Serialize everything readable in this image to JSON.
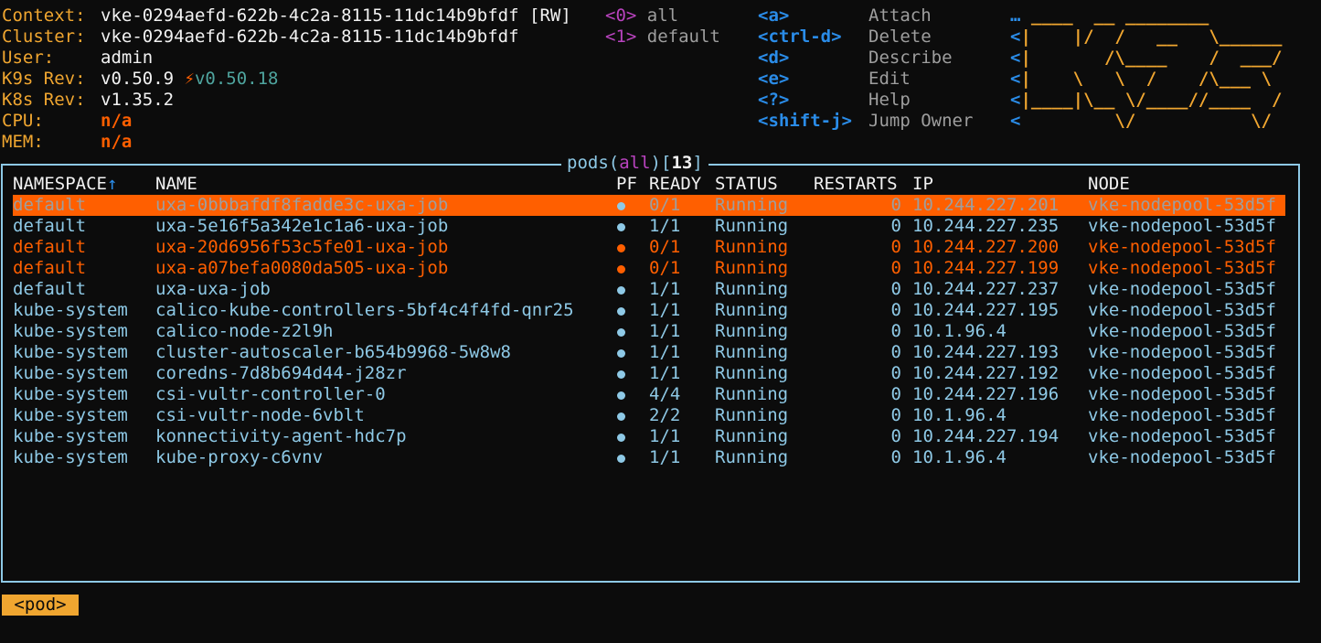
{
  "header": {
    "context_label": "Context:",
    "context_value": "vke-0294aefd-622b-4c2a-8115-11dc14b9bfdf",
    "rw": "[RW]",
    "cluster_label": "Cluster:",
    "cluster_value": "vke-0294aefd-622b-4c2a-8115-11dc14b9bfdf",
    "user_label": "User:",
    "user_value": "admin",
    "k9s_label": "K9s Rev:",
    "k9s_value": "v0.50.9",
    "k9s_update": "v0.50.18",
    "k8s_label": "K8s Rev:",
    "k8s_value": "v1.35.2",
    "cpu_label": "CPU:",
    "cpu_value": "n/a",
    "mem_label": "MEM:",
    "mem_value": "n/a"
  },
  "namespaces": [
    {
      "key": "<0>",
      "name": "all"
    },
    {
      "key": "<1>",
      "name": "default"
    }
  ],
  "hints": [
    {
      "key": "<a>",
      "label": "Attach"
    },
    {
      "key": "<ctrl-d>",
      "label": "Delete"
    },
    {
      "key": "<d>",
      "label": "Describe"
    },
    {
      "key": "<e>",
      "label": "Edit"
    },
    {
      "key": "<?>",
      "label": "Help"
    },
    {
      "key": "<shift-j>",
      "label": "Jump Owner"
    }
  ],
  "logo": [
    " ____  __ ________",
    "|    |/  /   __   \\______",
    "|       /\\____    /  ___/",
    "|    \\   \\  /    /\\___ \\",
    "|____|\\__ \\/____//____  /",
    "         \\/           \\/"
  ],
  "logo_prefix": [
    "…",
    "<",
    "<",
    "<",
    "<",
    "<"
  ],
  "table": {
    "title_resource": "pods",
    "title_scope": "all",
    "title_count": "13",
    "columns": [
      "NAMESPACE↑",
      "NAME",
      "PF",
      "READY",
      "STATUS",
      "RESTARTS",
      "IP",
      "NODE"
    ],
    "rows": [
      {
        "namespace": "default",
        "name": "uxa-0bbbafdf8fadde3c-uxa-job",
        "ready": "0/1",
        "status": "Running",
        "restarts": "0",
        "ip": "10.244.227.201",
        "node": "vke-nodepool-53d5f",
        "state": "sel"
      },
      {
        "namespace": "default",
        "name": "uxa-5e16f5a342e1c1a6-uxa-job",
        "ready": "1/1",
        "status": "Running",
        "restarts": "0",
        "ip": "10.244.227.235",
        "node": "vke-nodepool-53d5f",
        "state": "ok"
      },
      {
        "namespace": "default",
        "name": "uxa-20d6956f53c5fe01-uxa-job",
        "ready": "0/1",
        "status": "Running",
        "restarts": "0",
        "ip": "10.244.227.200",
        "node": "vke-nodepool-53d5f",
        "state": "err"
      },
      {
        "namespace": "default",
        "name": "uxa-a07befa0080da505-uxa-job",
        "ready": "0/1",
        "status": "Running",
        "restarts": "0",
        "ip": "10.244.227.199",
        "node": "vke-nodepool-53d5f",
        "state": "err"
      },
      {
        "namespace": "default",
        "name": "uxa-uxa-job",
        "ready": "1/1",
        "status": "Running",
        "restarts": "0",
        "ip": "10.244.227.237",
        "node": "vke-nodepool-53d5f",
        "state": "ok"
      },
      {
        "namespace": "kube-system",
        "name": "calico-kube-controllers-5bf4c4f4fd-qnr25",
        "ready": "1/1",
        "status": "Running",
        "restarts": "0",
        "ip": "10.244.227.195",
        "node": "vke-nodepool-53d5f",
        "state": "ok"
      },
      {
        "namespace": "kube-system",
        "name": "calico-node-z2l9h",
        "ready": "1/1",
        "status": "Running",
        "restarts": "0",
        "ip": "10.1.96.4",
        "node": "vke-nodepool-53d5f",
        "state": "ok"
      },
      {
        "namespace": "kube-system",
        "name": "cluster-autoscaler-b654b9968-5w8w8",
        "ready": "1/1",
        "status": "Running",
        "restarts": "0",
        "ip": "10.244.227.193",
        "node": "vke-nodepool-53d5f",
        "state": "ok"
      },
      {
        "namespace": "kube-system",
        "name": "coredns-7d8b694d44-j28zr",
        "ready": "1/1",
        "status": "Running",
        "restarts": "0",
        "ip": "10.244.227.192",
        "node": "vke-nodepool-53d5f",
        "state": "ok"
      },
      {
        "namespace": "kube-system",
        "name": "csi-vultr-controller-0",
        "ready": "4/4",
        "status": "Running",
        "restarts": "0",
        "ip": "10.244.227.196",
        "node": "vke-nodepool-53d5f",
        "state": "ok"
      },
      {
        "namespace": "kube-system",
        "name": "csi-vultr-node-6vblt",
        "ready": "2/2",
        "status": "Running",
        "restarts": "0",
        "ip": "10.1.96.4",
        "node": "vke-nodepool-53d5f",
        "state": "ok"
      },
      {
        "namespace": "kube-system",
        "name": "konnectivity-agent-hdc7p",
        "ready": "1/1",
        "status": "Running",
        "restarts": "0",
        "ip": "10.244.227.194",
        "node": "vke-nodepool-53d5f",
        "state": "ok"
      },
      {
        "namespace": "kube-system",
        "name": "kube-proxy-c6vnv",
        "ready": "1/1",
        "status": "Running",
        "restarts": "0",
        "ip": "10.1.96.4",
        "node": "vke-nodepool-53d5f",
        "state": "ok"
      }
    ]
  },
  "crumb": "<pod>",
  "colors": {
    "label": "#f0a630",
    "key": "#2a8ce8",
    "row_ok": "#8ec9e6",
    "row_err": "#ff5f00",
    "selection": "#ff5f00",
    "border": "#8ec9e6",
    "namespace_key": "#b943bf"
  }
}
